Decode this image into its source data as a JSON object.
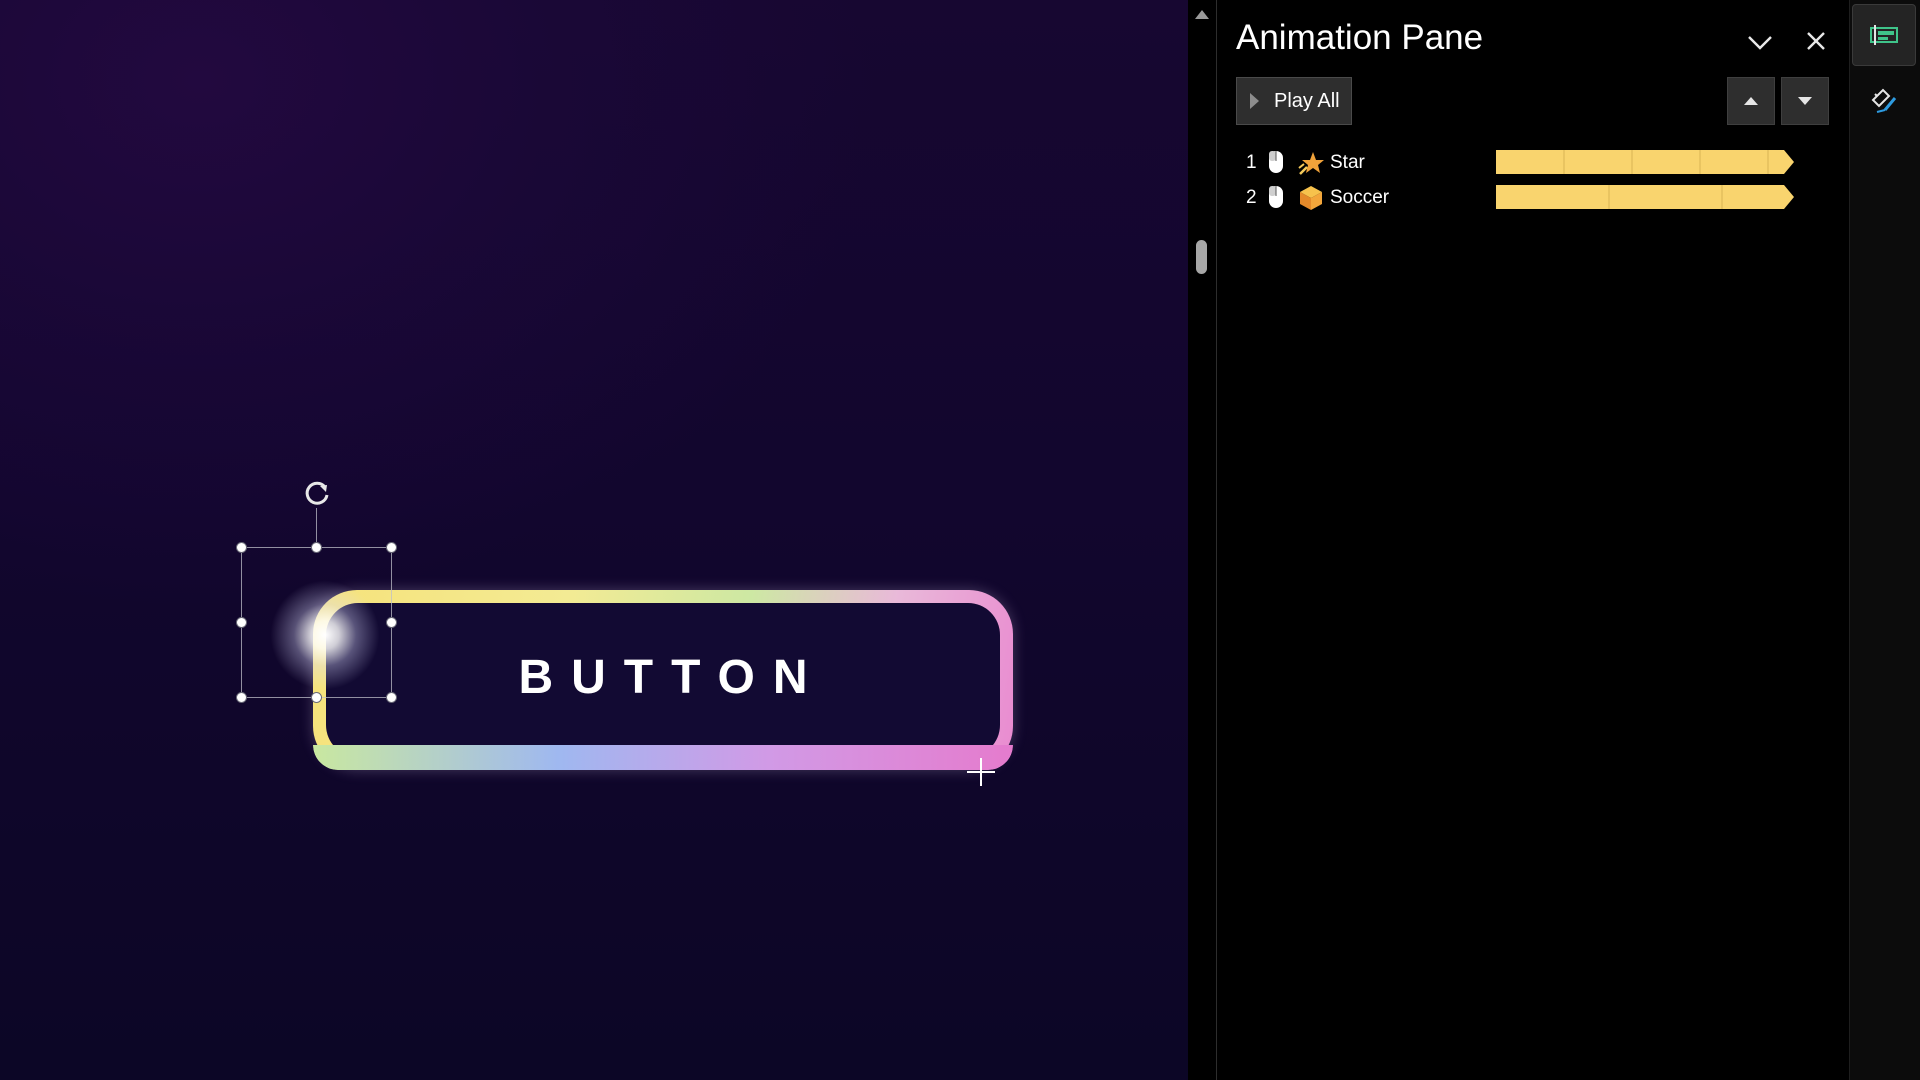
{
  "slide": {
    "button_text": "BUTTON"
  },
  "pane": {
    "title": "Animation Pane",
    "play_all_label": "Play All",
    "items": [
      {
        "number": "1",
        "label": "Star",
        "trigger_icon": "mouse-click-icon",
        "effect_icon": "star-effect-icon"
      },
      {
        "number": "2",
        "label": "Soccer",
        "trigger_icon": "mouse-click-icon",
        "effect_icon": "cube-effect-icon"
      }
    ]
  },
  "colors": {
    "timeline_bar": "#f9d46e",
    "slide_background": "#120a33",
    "pane_background": "#000000"
  }
}
